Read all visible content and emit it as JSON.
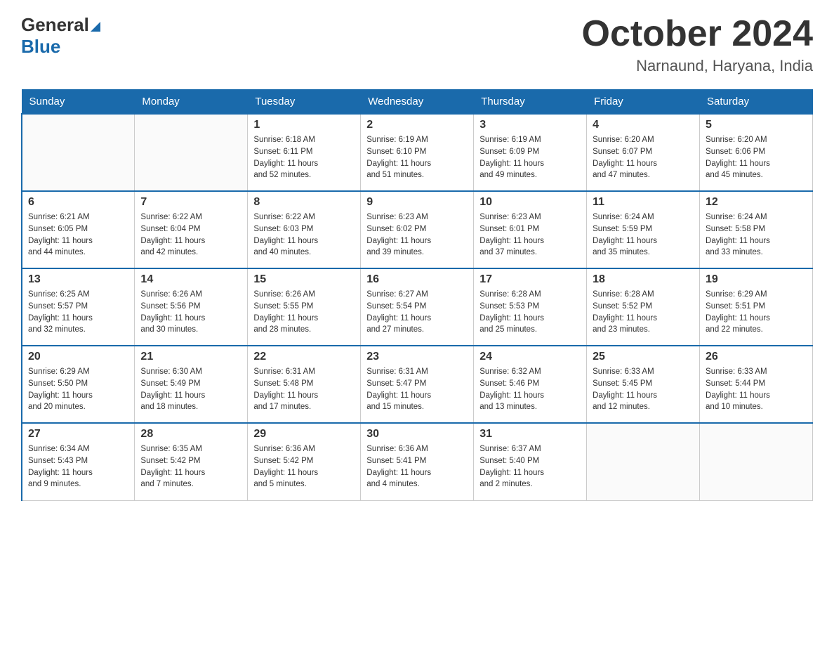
{
  "header": {
    "logo_general": "General",
    "logo_blue": "Blue",
    "month_title": "October 2024",
    "location": "Narnaund, Haryana, India"
  },
  "weekdays": [
    "Sunday",
    "Monday",
    "Tuesday",
    "Wednesday",
    "Thursday",
    "Friday",
    "Saturday"
  ],
  "weeks": [
    [
      {
        "day": "",
        "info": ""
      },
      {
        "day": "",
        "info": ""
      },
      {
        "day": "1",
        "info": "Sunrise: 6:18 AM\nSunset: 6:11 PM\nDaylight: 11 hours\nand 52 minutes."
      },
      {
        "day": "2",
        "info": "Sunrise: 6:19 AM\nSunset: 6:10 PM\nDaylight: 11 hours\nand 51 minutes."
      },
      {
        "day": "3",
        "info": "Sunrise: 6:19 AM\nSunset: 6:09 PM\nDaylight: 11 hours\nand 49 minutes."
      },
      {
        "day": "4",
        "info": "Sunrise: 6:20 AM\nSunset: 6:07 PM\nDaylight: 11 hours\nand 47 minutes."
      },
      {
        "day": "5",
        "info": "Sunrise: 6:20 AM\nSunset: 6:06 PM\nDaylight: 11 hours\nand 45 minutes."
      }
    ],
    [
      {
        "day": "6",
        "info": "Sunrise: 6:21 AM\nSunset: 6:05 PM\nDaylight: 11 hours\nand 44 minutes."
      },
      {
        "day": "7",
        "info": "Sunrise: 6:22 AM\nSunset: 6:04 PM\nDaylight: 11 hours\nand 42 minutes."
      },
      {
        "day": "8",
        "info": "Sunrise: 6:22 AM\nSunset: 6:03 PM\nDaylight: 11 hours\nand 40 minutes."
      },
      {
        "day": "9",
        "info": "Sunrise: 6:23 AM\nSunset: 6:02 PM\nDaylight: 11 hours\nand 39 minutes."
      },
      {
        "day": "10",
        "info": "Sunrise: 6:23 AM\nSunset: 6:01 PM\nDaylight: 11 hours\nand 37 minutes."
      },
      {
        "day": "11",
        "info": "Sunrise: 6:24 AM\nSunset: 5:59 PM\nDaylight: 11 hours\nand 35 minutes."
      },
      {
        "day": "12",
        "info": "Sunrise: 6:24 AM\nSunset: 5:58 PM\nDaylight: 11 hours\nand 33 minutes."
      }
    ],
    [
      {
        "day": "13",
        "info": "Sunrise: 6:25 AM\nSunset: 5:57 PM\nDaylight: 11 hours\nand 32 minutes."
      },
      {
        "day": "14",
        "info": "Sunrise: 6:26 AM\nSunset: 5:56 PM\nDaylight: 11 hours\nand 30 minutes."
      },
      {
        "day": "15",
        "info": "Sunrise: 6:26 AM\nSunset: 5:55 PM\nDaylight: 11 hours\nand 28 minutes."
      },
      {
        "day": "16",
        "info": "Sunrise: 6:27 AM\nSunset: 5:54 PM\nDaylight: 11 hours\nand 27 minutes."
      },
      {
        "day": "17",
        "info": "Sunrise: 6:28 AM\nSunset: 5:53 PM\nDaylight: 11 hours\nand 25 minutes."
      },
      {
        "day": "18",
        "info": "Sunrise: 6:28 AM\nSunset: 5:52 PM\nDaylight: 11 hours\nand 23 minutes."
      },
      {
        "day": "19",
        "info": "Sunrise: 6:29 AM\nSunset: 5:51 PM\nDaylight: 11 hours\nand 22 minutes."
      }
    ],
    [
      {
        "day": "20",
        "info": "Sunrise: 6:29 AM\nSunset: 5:50 PM\nDaylight: 11 hours\nand 20 minutes."
      },
      {
        "day": "21",
        "info": "Sunrise: 6:30 AM\nSunset: 5:49 PM\nDaylight: 11 hours\nand 18 minutes."
      },
      {
        "day": "22",
        "info": "Sunrise: 6:31 AM\nSunset: 5:48 PM\nDaylight: 11 hours\nand 17 minutes."
      },
      {
        "day": "23",
        "info": "Sunrise: 6:31 AM\nSunset: 5:47 PM\nDaylight: 11 hours\nand 15 minutes."
      },
      {
        "day": "24",
        "info": "Sunrise: 6:32 AM\nSunset: 5:46 PM\nDaylight: 11 hours\nand 13 minutes."
      },
      {
        "day": "25",
        "info": "Sunrise: 6:33 AM\nSunset: 5:45 PM\nDaylight: 11 hours\nand 12 minutes."
      },
      {
        "day": "26",
        "info": "Sunrise: 6:33 AM\nSunset: 5:44 PM\nDaylight: 11 hours\nand 10 minutes."
      }
    ],
    [
      {
        "day": "27",
        "info": "Sunrise: 6:34 AM\nSunset: 5:43 PM\nDaylight: 11 hours\nand 9 minutes."
      },
      {
        "day": "28",
        "info": "Sunrise: 6:35 AM\nSunset: 5:42 PM\nDaylight: 11 hours\nand 7 minutes."
      },
      {
        "day": "29",
        "info": "Sunrise: 6:36 AM\nSunset: 5:42 PM\nDaylight: 11 hours\nand 5 minutes."
      },
      {
        "day": "30",
        "info": "Sunrise: 6:36 AM\nSunset: 5:41 PM\nDaylight: 11 hours\nand 4 minutes."
      },
      {
        "day": "31",
        "info": "Sunrise: 6:37 AM\nSunset: 5:40 PM\nDaylight: 11 hours\nand 2 minutes."
      },
      {
        "day": "",
        "info": ""
      },
      {
        "day": "",
        "info": ""
      }
    ]
  ]
}
